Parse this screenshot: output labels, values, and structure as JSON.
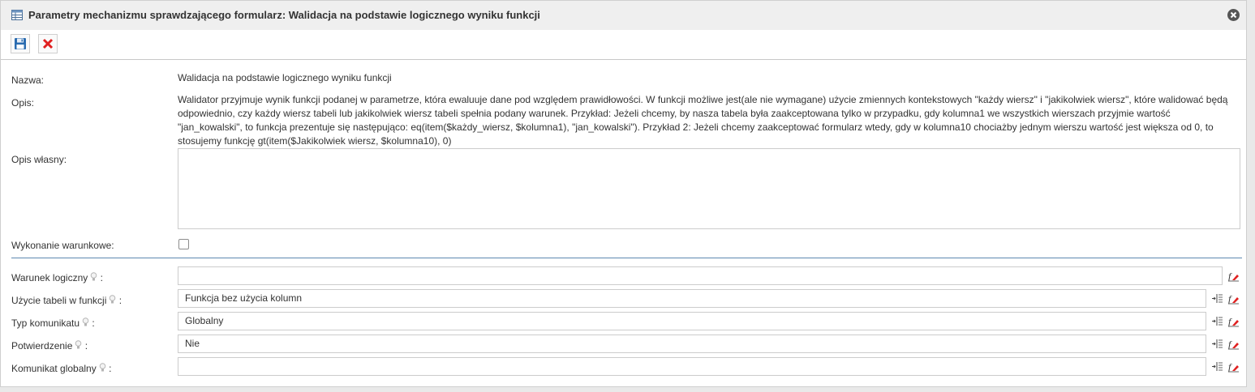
{
  "dialog": {
    "title": "Parametry mechanizmu sprawdzającego formularz: Walidacja na podstawie logicznego wyniku funkcji",
    "icons": {
      "title": "table-icon",
      "close": "close-circle-icon"
    }
  },
  "toolbar": {
    "save_icon": "floppy-disk-icon",
    "delete_icon": "red-x-icon"
  },
  "form": {
    "nazwa_label": "Nazwa:",
    "nazwa_value": "Walidacja na podstawie logicznego wyniku funkcji",
    "opis_label": "Opis:",
    "opis_value": "Walidator przyjmuje wynik funkcji podanej w parametrze, która ewaluuje dane pod względem prawidłowości. W funkcji możliwe jest(ale nie wymagane) użycie zmiennych kontekstowych \"każdy wiersz\" i \"jakikolwiek wiersz\", które walidować będą odpowiednio, czy każdy wiersz tabeli lub jakikolwiek wiersz tabeli spełnia podany warunek. Przykład: Jeżeli chcemy, by nasza tabela była zaakceptowana tylko w przypadku, gdy kolumna1 we wszystkich wierszach przyjmie wartość \"jan_kowalski\", to funkcja prezentuje się następująco: eq(item($każdy_wiersz, $kolumna1), \"jan_kowalski\"). Przykład 2: Jeżeli chcemy zaakceptować formularz wtedy, gdy w kolumna10 chociażby jednym wierszu wartość jest większa od 0, to stosujemy funkcję gt(item($Jakikolwiek wiersz, $kolumna10), 0)",
    "opis_wlasny_label": "Opis własny:",
    "opis_wlasny_value": "",
    "wykonanie_label": "Wykonanie warunkowe:",
    "wykonanie_checked": false,
    "warunek_label": "Warunek logiczny",
    "warunek_value": "",
    "uzycie_label": "Użycie tabeli w funkcji",
    "uzycie_value": "Funkcja bez użycia kolumn",
    "typ_label": "Typ komunikatu",
    "typ_value": "Globalny",
    "potwierdzenie_label": "Potwierdzenie",
    "potwierdzenie_value": "Nie",
    "komunikat_label": "Komunikat globalny",
    "komunikat_value": "",
    "colon": ":"
  },
  "icons": {
    "hint": "lightbulb-icon",
    "insert": "insert-column-icon",
    "clear": "function-eraser-icon"
  },
  "colors": {
    "separator": "#5e88b0",
    "delete": "#e02020",
    "save": "#2b6cb0"
  }
}
